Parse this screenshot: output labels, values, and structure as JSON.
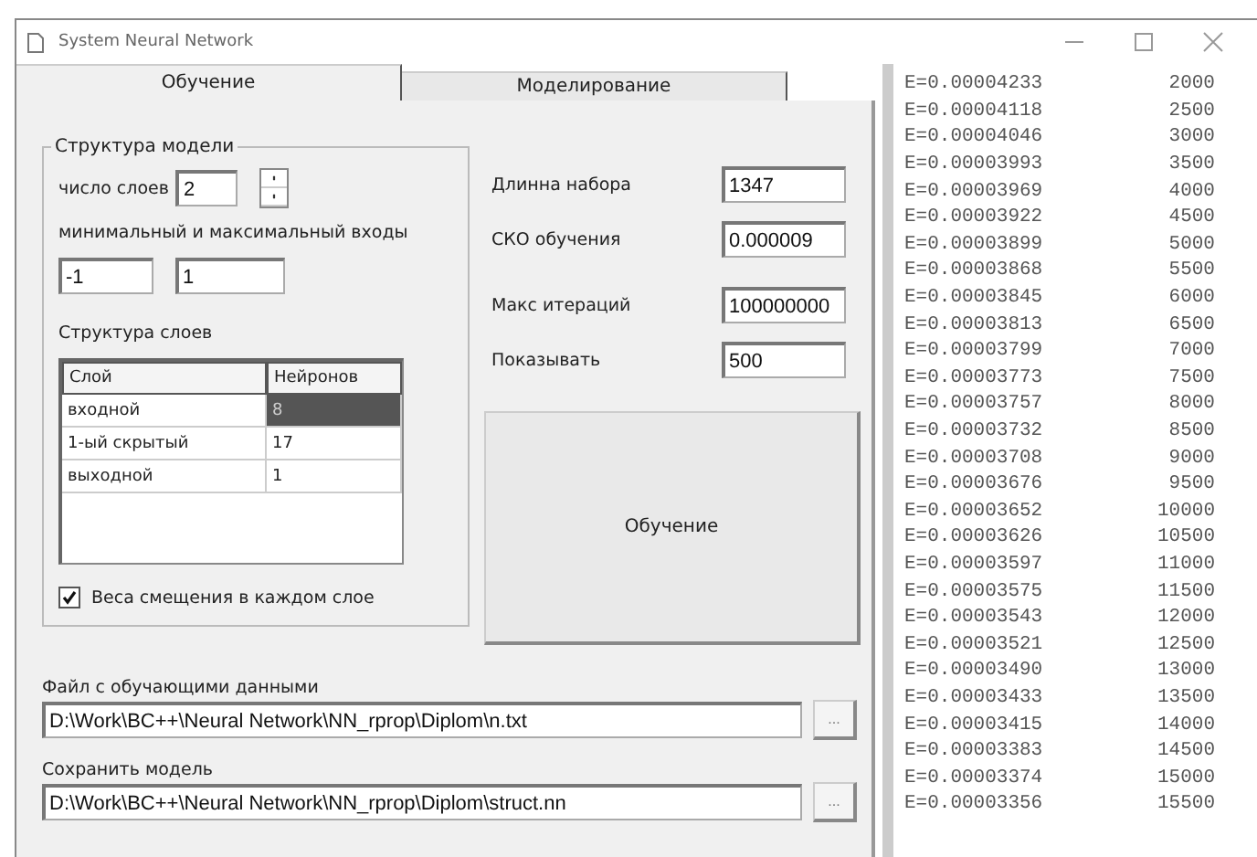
{
  "window": {
    "title": "System Neural Network"
  },
  "tabs": [
    {
      "label": "Обучение",
      "selected": true
    },
    {
      "label": "Моделирование",
      "selected": false
    }
  ],
  "model_structure": {
    "title": "Структура модели",
    "layers_label": "число слоев",
    "layers_value": "2",
    "range_label": "минимальный и максимальный входы",
    "min_value": "-1",
    "max_value": "1",
    "layers_title": "Структура слоев",
    "columns": [
      "Слой",
      "Нейронов"
    ],
    "rows": [
      {
        "layer": "входной",
        "neurons": "8",
        "selected": true
      },
      {
        "layer": "1-ый скрытый",
        "neurons": "17",
        "selected": false
      },
      {
        "layer": "выходной",
        "neurons": "1",
        "selected": false
      }
    ],
    "bias": {
      "label": "Веса смещения в каждом слое",
      "checked": true
    }
  },
  "params": [
    {
      "label": "Длинна набора",
      "value": "1347"
    },
    {
      "label": "СКО обучения",
      "value": "0.000009"
    },
    {
      "label": "Макс итераций",
      "value": "100000000"
    },
    {
      "label": "Показывать",
      "value": "500"
    }
  ],
  "train_button": "Обучение",
  "files": [
    {
      "label": "Файл с обучающими данными",
      "value": "D:\\Work\\BC++\\Neural Network\\NN_rprop\\Diplom\\n.txt",
      "button": "..."
    },
    {
      "label": "Сохранить модель",
      "value": "D:\\Work\\BC++\\Neural Network\\NN_rprop\\Diplom\\struct.nn",
      "button": "..."
    }
  ],
  "log": [
    {
      "error": "E=0.00004233",
      "iteration": "2000"
    },
    {
      "error": "E=0.00004118",
      "iteration": "2500"
    },
    {
      "error": "E=0.00004046",
      "iteration": "3000"
    },
    {
      "error": "E=0.00003993",
      "iteration": "3500"
    },
    {
      "error": "E=0.00003969",
      "iteration": "4000"
    },
    {
      "error": "E=0.00003922",
      "iteration": "4500"
    },
    {
      "error": "E=0.00003899",
      "iteration": "5000"
    },
    {
      "error": "E=0.00003868",
      "iteration": "5500"
    },
    {
      "error": "E=0.00003845",
      "iteration": "6000"
    },
    {
      "error": "E=0.00003813",
      "iteration": "6500"
    },
    {
      "error": "E=0.00003799",
      "iteration": "7000"
    },
    {
      "error": "E=0.00003773",
      "iteration": "7500"
    },
    {
      "error": "E=0.00003757",
      "iteration": "8000"
    },
    {
      "error": "E=0.00003732",
      "iteration": "8500"
    },
    {
      "error": "E=0.00003708",
      "iteration": "9000"
    },
    {
      "error": "E=0.00003676",
      "iteration": "9500"
    },
    {
      "error": "E=0.00003652",
      "iteration": "10000"
    },
    {
      "error": "E=0.00003626",
      "iteration": "10500"
    },
    {
      "error": "E=0.00003597",
      "iteration": "11000"
    },
    {
      "error": "E=0.00003575",
      "iteration": "11500"
    },
    {
      "error": "E=0.00003543",
      "iteration": "12000"
    },
    {
      "error": "E=0.00003521",
      "iteration": "12500"
    },
    {
      "error": "E=0.00003490",
      "iteration": "13000"
    },
    {
      "error": "E=0.00003433",
      "iteration": "13500"
    },
    {
      "error": "E=0.00003415",
      "iteration": "14000"
    },
    {
      "error": "E=0.00003383",
      "iteration": "14500"
    },
    {
      "error": "E=0.00003374",
      "iteration": "15000"
    },
    {
      "error": "E=0.00003356",
      "iteration": "15500"
    }
  ]
}
